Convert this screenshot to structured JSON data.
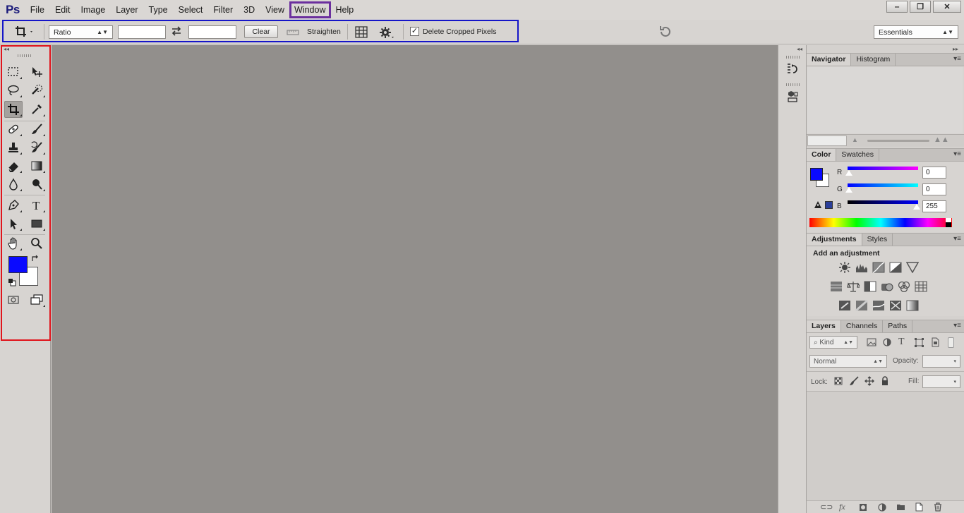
{
  "app": {
    "logo": "Ps"
  },
  "menu": {
    "items": [
      "File",
      "Edit",
      "Image",
      "Layer",
      "Type",
      "Select",
      "Filter",
      "3D",
      "View",
      "Window",
      "Help"
    ],
    "highlighted": "Window"
  },
  "window_controls": {
    "minimize": "‒",
    "restore": "❐",
    "close": "✕"
  },
  "options_bar": {
    "ratio_select": "Ratio",
    "width_value": "",
    "height_value": "",
    "clear_label": "Clear",
    "straighten_label": "Straighten",
    "delete_cropped_label": "Delete Cropped Pixels",
    "delete_cropped_checked": true,
    "workspace_select": "Essentials"
  },
  "toolbox": {
    "tools": [
      "rectangular-marquee",
      "move",
      "lasso",
      "quick-selection",
      "crop",
      "eyedropper",
      "spot-healing-brush",
      "brush",
      "clone-stamp",
      "history-brush",
      "eraser",
      "gradient",
      "blur",
      "dodge",
      "pen",
      "type",
      "path-selection",
      "rectangle",
      "hand",
      "zoom"
    ],
    "active_tool": "crop",
    "foreground_color": "#0a0aff",
    "background_color": "#ffffff"
  },
  "navigator_panel": {
    "tabs": [
      "Navigator",
      "Histogram"
    ]
  },
  "color_panel": {
    "tabs": [
      "Color",
      "Swatches"
    ],
    "channels": [
      {
        "label": "R",
        "value": "0"
      },
      {
        "label": "G",
        "value": "0"
      },
      {
        "label": "B",
        "value": "255"
      }
    ]
  },
  "adjustments_panel": {
    "tabs": [
      "Adjustments",
      "Styles"
    ],
    "heading": "Add an adjustment"
  },
  "layers_panel": {
    "tabs": [
      "Layers",
      "Channels",
      "Paths"
    ],
    "filter_label": "Kind",
    "blend_mode": "Normal",
    "opacity_label": "Opacity:",
    "lock_label": "Lock:",
    "fill_label": "Fill:"
  },
  "colors": {
    "menu_highlight": "#6b2f9e",
    "options_highlight": "#1515c8",
    "toolbox_highlight": "#e0141c",
    "canvas": "#928f8c"
  }
}
